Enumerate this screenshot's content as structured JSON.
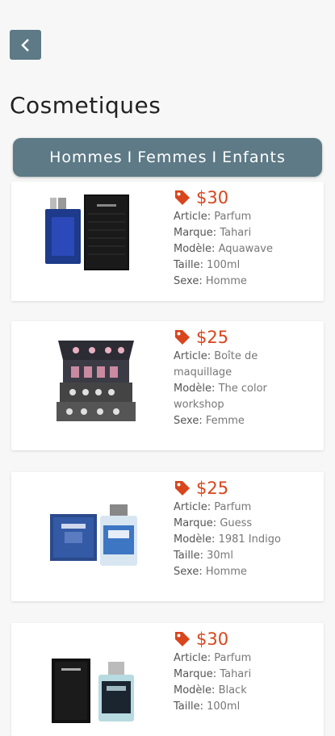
{
  "header": {
    "title": "Cosmetiques"
  },
  "filters": [
    "Hommes",
    "Femmes",
    "Enfants"
  ],
  "filter_separator": "I",
  "labels": {
    "article": "Article:",
    "marque": "Marque:",
    "modele": "Modèle:",
    "taille": "Taille:",
    "sexe": "Sexe:"
  },
  "products": [
    {
      "price": "$30",
      "article": "Parfum",
      "marque": "Tahari",
      "modele": "Aquawave",
      "taille": "100ml",
      "sexe": "Homme"
    },
    {
      "price": "$25",
      "article": "Boîte de maquillage",
      "modele": "The color workshop",
      "sexe": "Femme"
    },
    {
      "price": "$25",
      "article": "Parfum",
      "marque": "Guess",
      "modele": "1981 Indigo",
      "taille": "30ml",
      "sexe": "Homme"
    },
    {
      "price": "$30",
      "article": "Parfum",
      "marque": "Tahari",
      "modele": "Black",
      "taille": "100ml"
    }
  ],
  "colors": {
    "accent": "#5d7a86",
    "price": "#d9451c",
    "background": "#f7f7f7"
  },
  "icons": {
    "back": "chevron-left-icon",
    "tag": "price-tag-icon"
  }
}
